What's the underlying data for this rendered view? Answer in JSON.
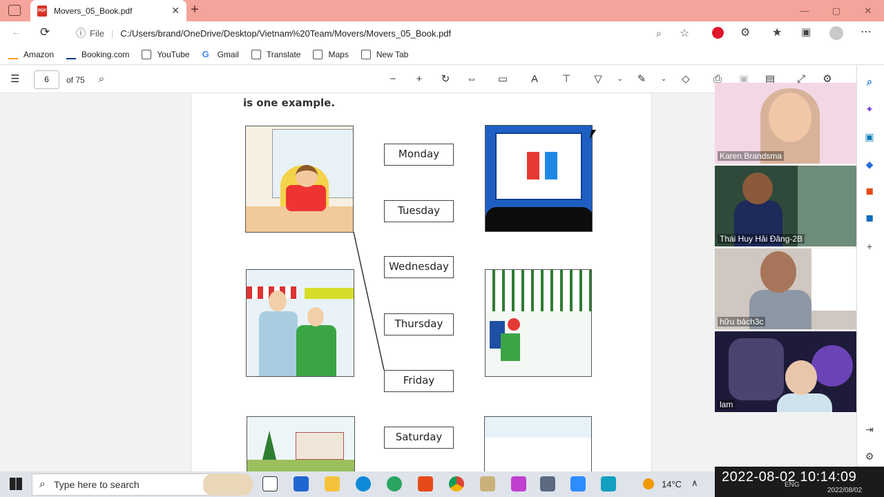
{
  "browser": {
    "tab_title": "Movers_05_Book.pdf",
    "tab_close": "✕",
    "new_tab": "+",
    "url_label": "File",
    "url": "C:/Users/brand/OneDrive/Desktop/Vietnam%20Team/Movers/Movers_05_Book.pdf",
    "bookmarks": [
      "Amazon",
      "Booking.com",
      "YouTube",
      "Gmail",
      "Translate",
      "Maps",
      "New Tab"
    ]
  },
  "pdf": {
    "page_number": "6",
    "page_total": "of 75",
    "instruction_tail": "is one example.",
    "days": [
      "Monday",
      "Tuesday",
      "Wednesday",
      "Thursday",
      "Friday",
      "Saturday"
    ]
  },
  "video": {
    "participants": [
      "Karen Brandsma",
      "Thái Huy Hải Đăng-2B",
      "hữu bách3c",
      "lam"
    ]
  },
  "taskbar": {
    "search_placeholder": "Type here to search",
    "weather": "14°C",
    "lang": "ENG",
    "date_small": "2022/08/02",
    "timestamp_overlay": "2022-08-02  10:14:09"
  },
  "colors": {
    "titlebar": "#f4a49a",
    "accent": "#1a73e8"
  }
}
